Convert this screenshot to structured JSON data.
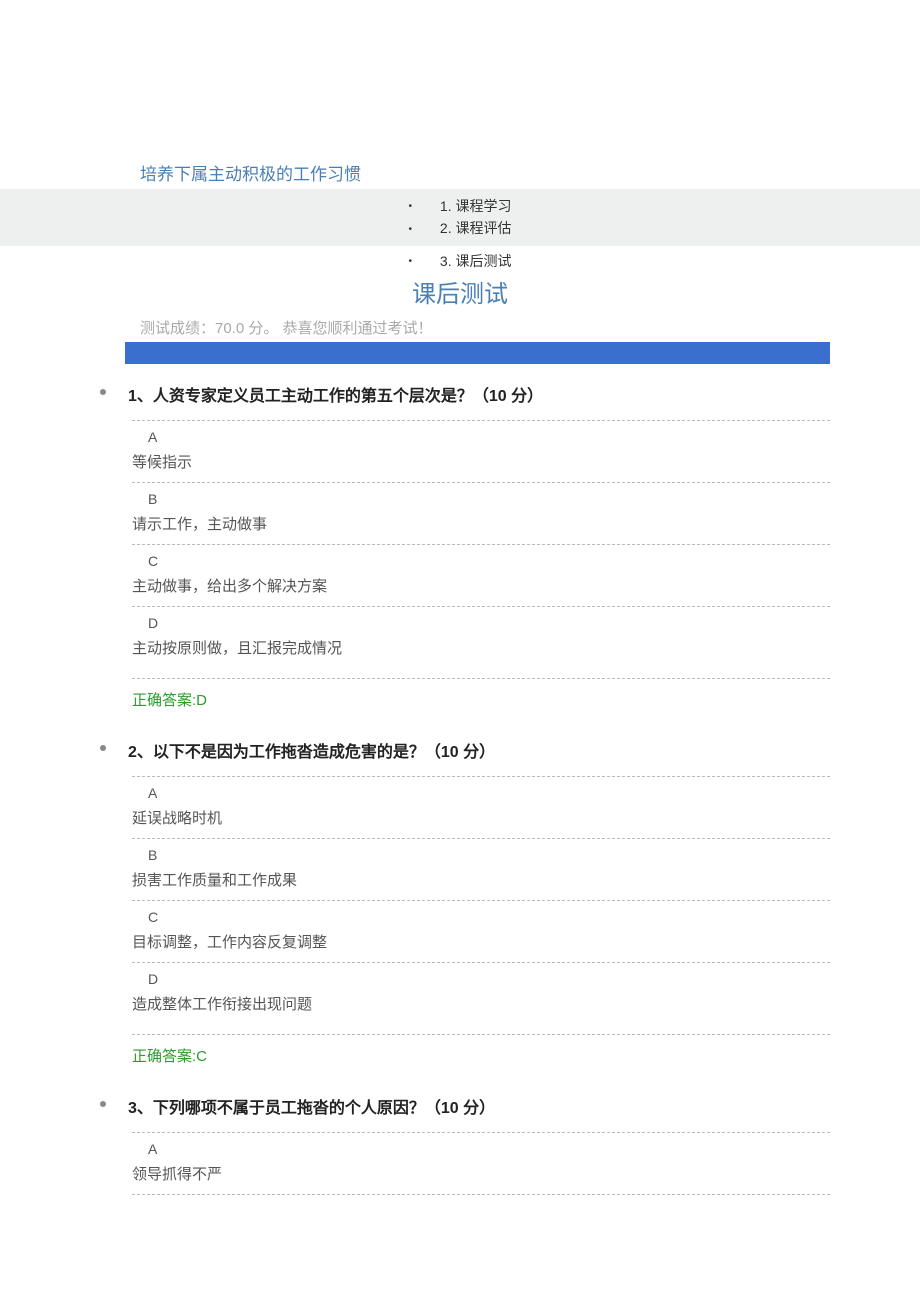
{
  "course": {
    "title": "培养下属主动积极的工作习惯"
  },
  "nav": {
    "items": [
      "1. 课程学习",
      "2. 课程评估",
      "3. 课后测试"
    ]
  },
  "section_title": "课后测试",
  "score_line": "测试成绩：70.0 分。  恭喜您顺利通过考试！",
  "answer_prefix": "正确答案:",
  "questions": [
    {
      "header": "1、人资专家定义员工主动工作的第五个层次是？（10   分）",
      "options": [
        {
          "letter": "A",
          "text": "等候指示"
        },
        {
          "letter": "B",
          "text": "请示工作，主动做事"
        },
        {
          "letter": "C",
          "text": "主动做事，给出多个解决方案"
        },
        {
          "letter": "D",
          "text": "主动按原则做，且汇报完成情况"
        }
      ],
      "answer": "D"
    },
    {
      "header": "2、以下不是因为工作拖沓造成危害的是？（10   分）",
      "options": [
        {
          "letter": "A",
          "text": "延误战略时机"
        },
        {
          "letter": "B",
          "text": "损害工作质量和工作成果"
        },
        {
          "letter": "C",
          "text": "目标调整，工作内容反复调整"
        },
        {
          "letter": "D",
          "text": "造成整体工作衔接出现问题"
        }
      ],
      "answer": "C"
    },
    {
      "header": "3、下列哪项不属于员工拖沓的个人原因？（10   分）",
      "options": [
        {
          "letter": "A",
          "text": "领导抓得不严"
        }
      ],
      "answer": null
    }
  ]
}
